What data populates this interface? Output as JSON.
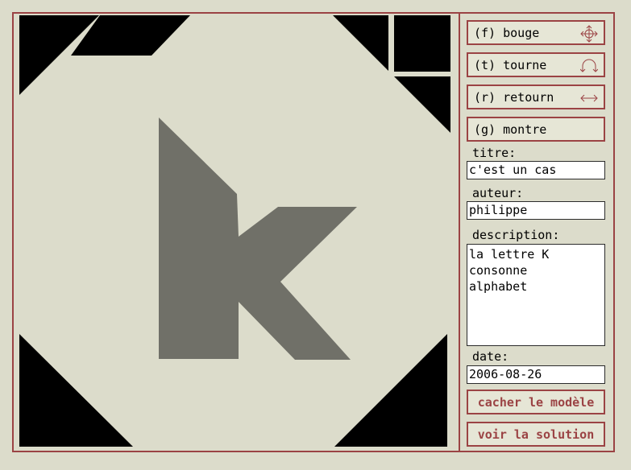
{
  "colors": {
    "frame": "#9b4344",
    "background": "#dcdccb",
    "board": "#dcdccb",
    "piece": "#000000",
    "silhouette": "#707068"
  },
  "modes": [
    {
      "label": "(f) bouge",
      "icon": "move-icon"
    },
    {
      "label": "(t) tourne",
      "icon": "rotate-icon"
    },
    {
      "label": "(r) retourn",
      "icon": "flip-icon"
    },
    {
      "label": "(g) montre",
      "icon": ""
    }
  ],
  "fields": {
    "title_label": "titre:",
    "title_value": "c'est un cas",
    "author_label": "auteur:",
    "author_value": "philippe",
    "description_label": "description:",
    "description_value": "la lettre K\nconsonne\nalphabet",
    "date_label": "date:",
    "date_value": "2006-08-26"
  },
  "actions": {
    "hide_model": "cacher le modèle",
    "show_solution": "voir la solution"
  }
}
